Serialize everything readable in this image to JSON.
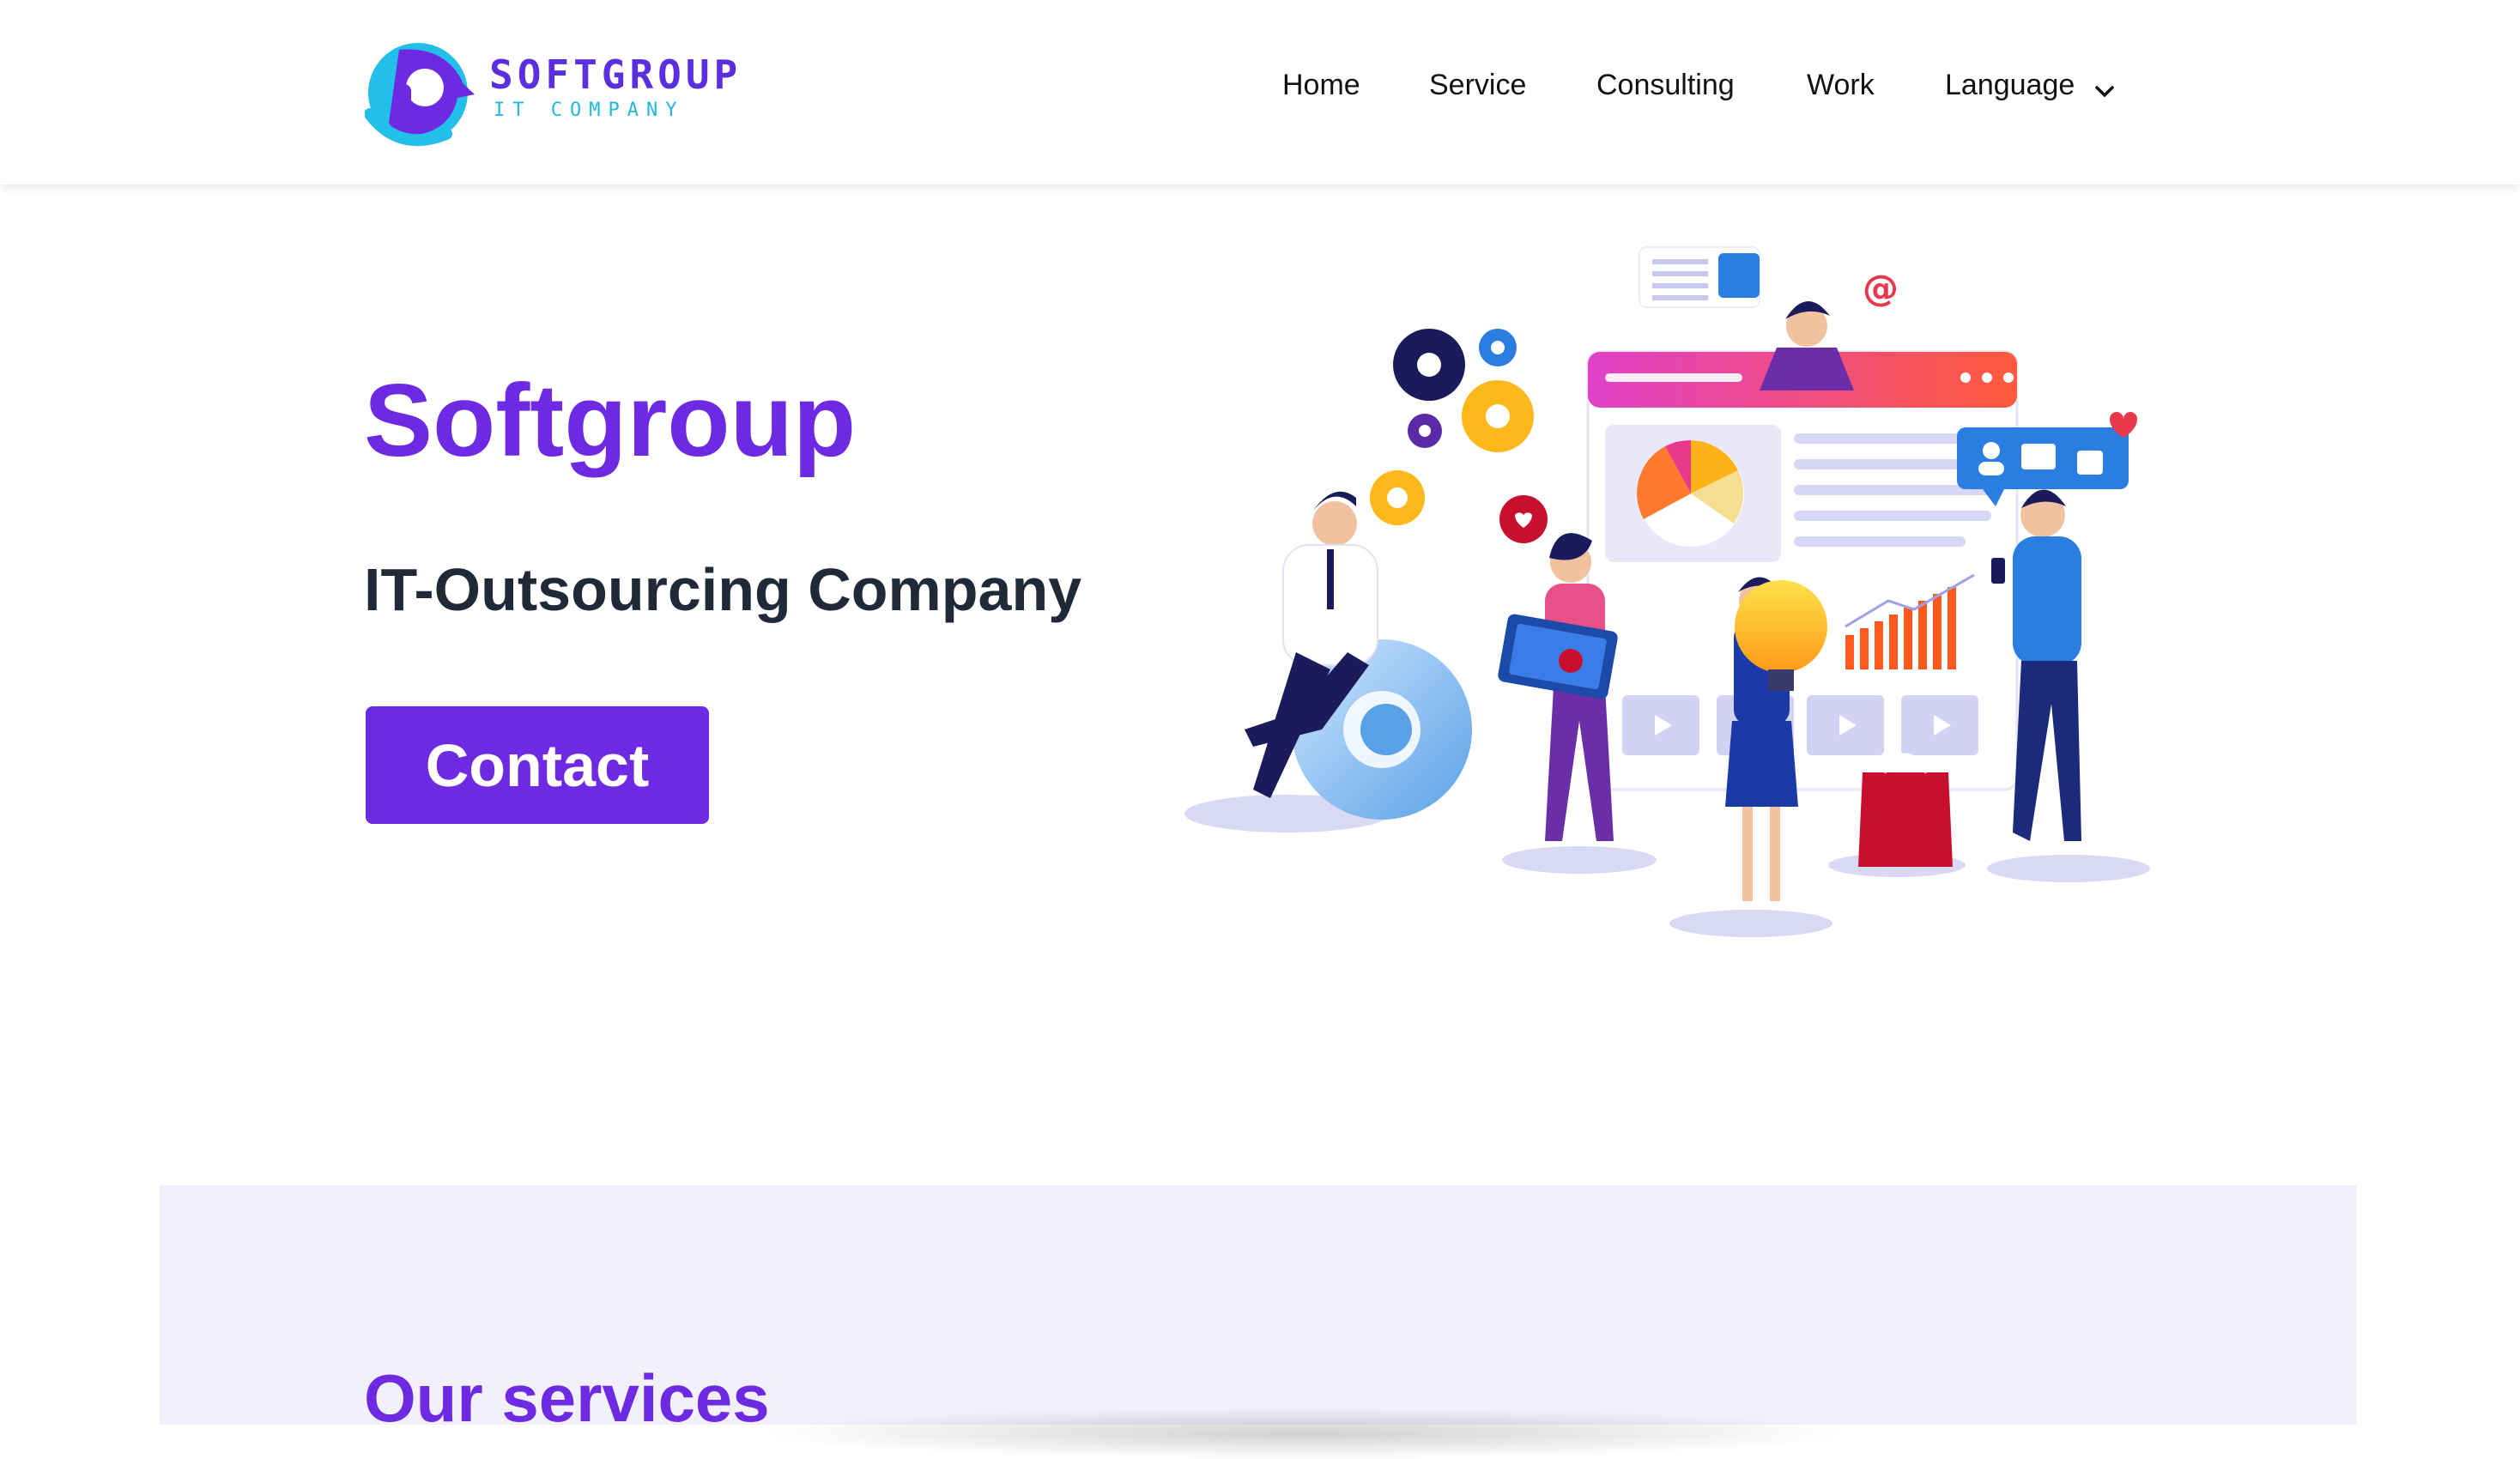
{
  "brand": {
    "name": "SOFTGROUP",
    "tagline": "IT COMPANY",
    "colors": {
      "primary": "#6d2ae2",
      "accent": "#22b8e0",
      "band": "#f1f0fb",
      "text_dark": "#1f2937"
    }
  },
  "nav": {
    "items": [
      "Home",
      "Service",
      "Consulting",
      "Work",
      "Language"
    ],
    "language_icon": "chevron-down-icon"
  },
  "hero": {
    "title": "Softgroup",
    "subtitle": "IT-Outsourcing Company",
    "cta_label": "Contact"
  },
  "services": {
    "title": "Our services"
  }
}
